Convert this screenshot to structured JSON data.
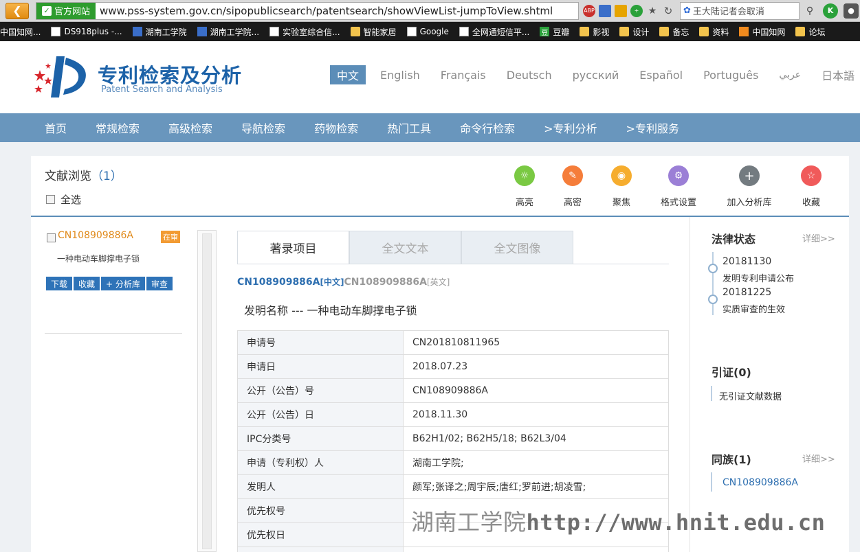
{
  "browser": {
    "secure_label": "官方网站",
    "url": "www.pss-system.gov.cn/sipopublicsearch/patentsearch/showViewList-jumpToView.shtml",
    "search_text": "王大陆记者会取消",
    "bookmarks": [
      "中国知网...",
      "DS918plus -...",
      "湖南工学院",
      "湖南工学院...",
      "实验室综合信...",
      "智能家居",
      "Google",
      "全网通短信平...",
      "豆瓣",
      "影视",
      "设计",
      "备忘",
      "资料",
      "中国知网",
      "论坛"
    ]
  },
  "site": {
    "title": "专利检索及分析",
    "subtitle": "Patent Search and Analysis",
    "languages": [
      "中文",
      "English",
      "Français",
      "Deutsch",
      "русский",
      "Español",
      "Português",
      "عربي",
      "日本語"
    ],
    "nav": [
      "首页",
      "常规检索",
      "高级检索",
      "导航检索",
      "药物检索",
      "热门工具",
      "命令行检索",
      ">专利分析",
      ">专利服务"
    ]
  },
  "panel": {
    "title": "文献浏览",
    "count": "1",
    "select_all": "全选",
    "tools": [
      "高亮",
      "高密",
      "聚焦",
      "格式设置",
      "加入分析库",
      "收藏"
    ]
  },
  "list_item": {
    "pub_no": "CN108909886A",
    "status": "在审",
    "name": "一种电动车脚撑电子锁",
    "actions": [
      "下载",
      "收藏",
      "+ 分析库",
      "审查"
    ]
  },
  "tabs": [
    "著录项目",
    "全文文本",
    "全文图像"
  ],
  "doc": {
    "pub_cn": "CN108909886A",
    "lang_cn": "[中文]",
    "pub_en": "CN108909886A",
    "lang_en": "[英文]",
    "invention_title": "发明名称 ---  一种电动车脚撑电子锁",
    "rows": [
      {
        "k": "申请号",
        "v": "CN201810811965"
      },
      {
        "k": "申请日",
        "v": "2018.07.23"
      },
      {
        "k": "公开（公告）号",
        "v": "CN108909886A"
      },
      {
        "k": "公开（公告）日",
        "v": "2018.11.30"
      },
      {
        "k": "IPC分类号",
        "v": "B62H1/02; B62H5/18; B62L3/04"
      },
      {
        "k": "申请（专利权）人",
        "v": "湖南工学院;"
      },
      {
        "k": "发明人",
        "v": "颜军;张译之;周宇辰;唐红;罗前进;胡凌雪;"
      },
      {
        "k": "优先权号",
        "v": ""
      },
      {
        "k": "优先权日",
        "v": ""
      },
      {
        "k": "",
        "v": ""
      }
    ]
  },
  "watermark": {
    "cn": "湖南工学院",
    "url": "http://www.hnit.edu.cn"
  },
  "sidebar": {
    "legal": {
      "title": "法律状态",
      "more": "详细>>",
      "events": [
        {
          "date": "20181130",
          "desc": "发明专利申请公布"
        },
        {
          "date": "20181225",
          "desc": "实质审查的生效"
        }
      ]
    },
    "citation": {
      "title": "引证(0)",
      "text": "无引证文献数据"
    },
    "family": {
      "title": "同族(1)",
      "more": "详细>>",
      "item": "CN108909886A"
    }
  }
}
